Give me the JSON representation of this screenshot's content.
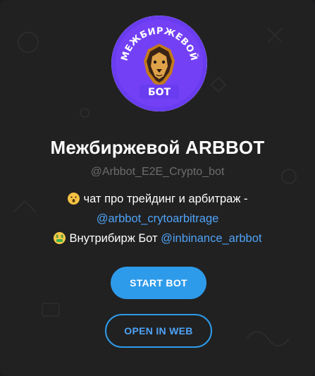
{
  "bot": {
    "name": "Межбиржевой ARBBOT",
    "handle": "@Arbbot_E2E_Crypto_bot",
    "avatar_text_top": "МЕЖБИРЖЕВОЙ",
    "avatar_text_bottom": "БОТ"
  },
  "description": {
    "line1_text": "чат про трейдинг и арбитраж -",
    "line1_emoji": "face-emoji",
    "line2_link": "@arbbot_crytoarbitrage",
    "line3_text": "Внутрибирж Бот",
    "line3_emoji": "money-mouth-emoji",
    "line3_link": "@inbinance_arbbot"
  },
  "buttons": {
    "start_label": "START BOT",
    "web_label": "OPEN IN WEB"
  },
  "colors": {
    "background": "#212121",
    "accent": "#2e9bea",
    "link": "#4fa3f7",
    "avatar_ring": "#6a3cf0"
  }
}
